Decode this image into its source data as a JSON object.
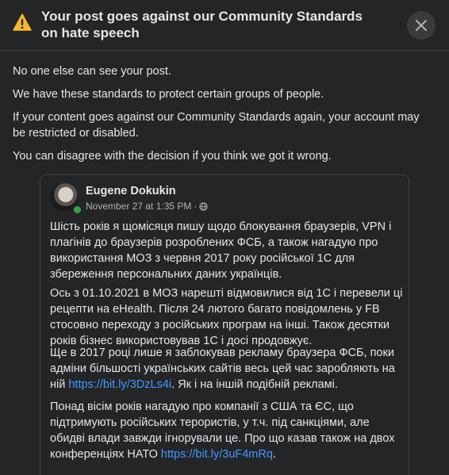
{
  "dialog": {
    "title": "Your post goes against our Community Standards on hate speech",
    "icons": {
      "warning": "warning-triangle-icon",
      "close": "close-icon"
    },
    "colors": {
      "warning": "#f7b928",
      "link": "#4599ff",
      "online": "#31a24c"
    }
  },
  "message": {
    "line1": "No one else can see your post.",
    "line2": "We have these standards to protect certain groups of people.",
    "line3": "If your content goes against our Community Standards again, your account may be restricted or disabled.",
    "line4": "You can disagree with the decision if you think we got it wrong."
  },
  "post": {
    "author": "Eugene Dokukin",
    "timestamp": "November 27 at 1:35 PM",
    "separator": "·",
    "privacy_icon": "globe-icon",
    "para1": "Шість років я щомісяця пишу щодо блокування браузерів, VPN і плагінів до браузерів розроблених ФСБ, а також нагадую про використання МОЗ з червня 2017 року російської 1С для збереження персональних даних українців.",
    "para2": "Ось з 01.10.2021 в МОЗ нарешті відмовилися від 1С і перевели ці рецепти на eHealth. Після 24 лютого багато повідомлень у FB стосовно переходу з російських програм на інші. Також десятки років бізнес використовував 1С і досі продовжує.",
    "para3_before": "Ще в 2017 році лише я заблокував рекламу браузера ФСБ, поки адміни більшості українських сайтів весь цей час заробляють на ній ",
    "para3_link": "https://bit.ly/3DzLs4i",
    "para3_after": ". Як і на іншій подібній рекламі.",
    "para4_before": "Понад вісім років нагадую про компанії з США та ЄС, що підтримують російських терористів, у т.ч. під санкціями, але обидві влади завжди ігнорували це. Про що казав також на двох конференціях НАТО ",
    "para4_link": "https://bit.ly/3uF4mRq",
    "para4_after": "."
  }
}
